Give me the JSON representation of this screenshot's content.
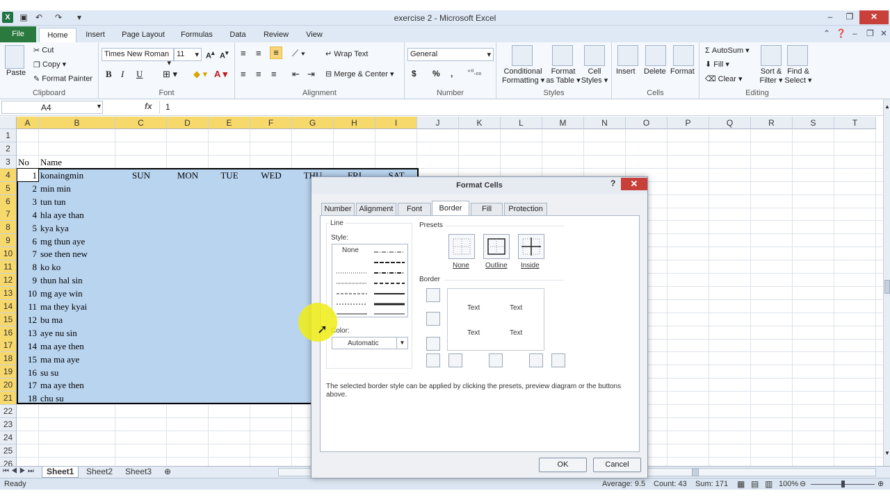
{
  "window": {
    "title": "exercise 2  -  Microsoft Excel",
    "app_icon": "X",
    "min": "–",
    "max": "❐",
    "close": "✕"
  },
  "ribbon_tabs": [
    "File",
    "Home",
    "Insert",
    "Page Layout",
    "Formulas",
    "Data",
    "Review",
    "View"
  ],
  "clipboard": {
    "paste": "Paste",
    "cut": "Cut",
    "copy": "Copy",
    "format_painter": "Format Painter",
    "label": "Clipboard"
  },
  "font": {
    "name": "Times New Roman",
    "size": "11",
    "label": "Font",
    "bold": "B",
    "italic": "I",
    "underline": "U"
  },
  "alignment": {
    "wrap": "Wrap Text",
    "merge": "Merge & Center",
    "label": "Alignment"
  },
  "number": {
    "format": "General",
    "currency": "$",
    "percent": "%",
    "comma": ",",
    "label": "Number"
  },
  "styles": {
    "cond1": "Conditional",
    "cond2": "Formatting",
    "fmt1": "Format",
    "fmt2": "as Table",
    "cell1": "Cell",
    "cell2": "Styles",
    "label": "Styles"
  },
  "cells": {
    "insert": "Insert",
    "delete": "Delete",
    "format": "Format",
    "label": "Cells"
  },
  "editing": {
    "autosum": "AutoSum",
    "fill": "Fill",
    "clear": "Clear",
    "sort1": "Sort &",
    "sort2": "Filter",
    "find1": "Find &",
    "find2": "Select",
    "label": "Editing"
  },
  "formula_bar": {
    "name_box": "A4",
    "fx": "fx",
    "value": "1"
  },
  "columns": [
    "A",
    "B",
    "C",
    "D",
    "E",
    "F",
    "G",
    "H",
    "I",
    "J",
    "K",
    "L",
    "M",
    "N",
    "O",
    "P",
    "Q",
    "R",
    "S",
    "T"
  ],
  "rows": [
    "1",
    "2",
    "3",
    "4",
    "5",
    "6",
    "7",
    "8",
    "9",
    "10",
    "11",
    "12",
    "13",
    "14",
    "15",
    "16",
    "17",
    "18",
    "19",
    "20",
    "21",
    "22",
    "23",
    "24",
    "25",
    "26"
  ],
  "header_row": {
    "no": "No",
    "name": "Name"
  },
  "days": [
    "SUN",
    "MON",
    "TUE",
    "WED",
    "THU",
    "FRI",
    "SAT"
  ],
  "table": [
    {
      "no": "1",
      "name": "konaingmin"
    },
    {
      "no": "2",
      "name": "min min"
    },
    {
      "no": "3",
      "name": "tun tun"
    },
    {
      "no": "4",
      "name": "hla aye than"
    },
    {
      "no": "5",
      "name": "kya kya"
    },
    {
      "no": "6",
      "name": "mg thun aye"
    },
    {
      "no": "7",
      "name": "soe then new"
    },
    {
      "no": "8",
      "name": "ko ko"
    },
    {
      "no": "9",
      "name": "thun hal sin"
    },
    {
      "no": "10",
      "name": "mg aye win"
    },
    {
      "no": "11",
      "name": "ma they kyai"
    },
    {
      "no": "12",
      "name": "bu ma"
    },
    {
      "no": "13",
      "name": "aye nu sin"
    },
    {
      "no": "14",
      "name": "ma aye then"
    },
    {
      "no": "15",
      "name": "ma ma aye"
    },
    {
      "no": "16",
      "name": "su su"
    },
    {
      "no": "17",
      "name": "ma aye then"
    },
    {
      "no": "18",
      "name": "chu su"
    }
  ],
  "sheets": [
    "Sheet1",
    "Sheet2",
    "Sheet3"
  ],
  "status": {
    "ready": "Ready",
    "average": "Average: 9.5",
    "count": "Count: 43",
    "sum": "Sum: 171",
    "zoom": "100%"
  },
  "dialog": {
    "title": "Format Cells",
    "help": "?",
    "close": "✕",
    "tabs": [
      "Number",
      "Alignment",
      "Font",
      "Border",
      "Fill",
      "Protection"
    ],
    "active_tab": "Border",
    "line": "Line",
    "style": "Style:",
    "none": "None",
    "color": "Color:",
    "color_value": "Automatic",
    "presets": "Presets",
    "preset_labels": [
      "None",
      "Outline",
      "Inside"
    ],
    "border": "Border",
    "preview_text": "Text",
    "hint": "The selected border style can be applied by clicking the presets, preview diagram or the buttons above.",
    "ok": "OK",
    "cancel": "Cancel"
  }
}
